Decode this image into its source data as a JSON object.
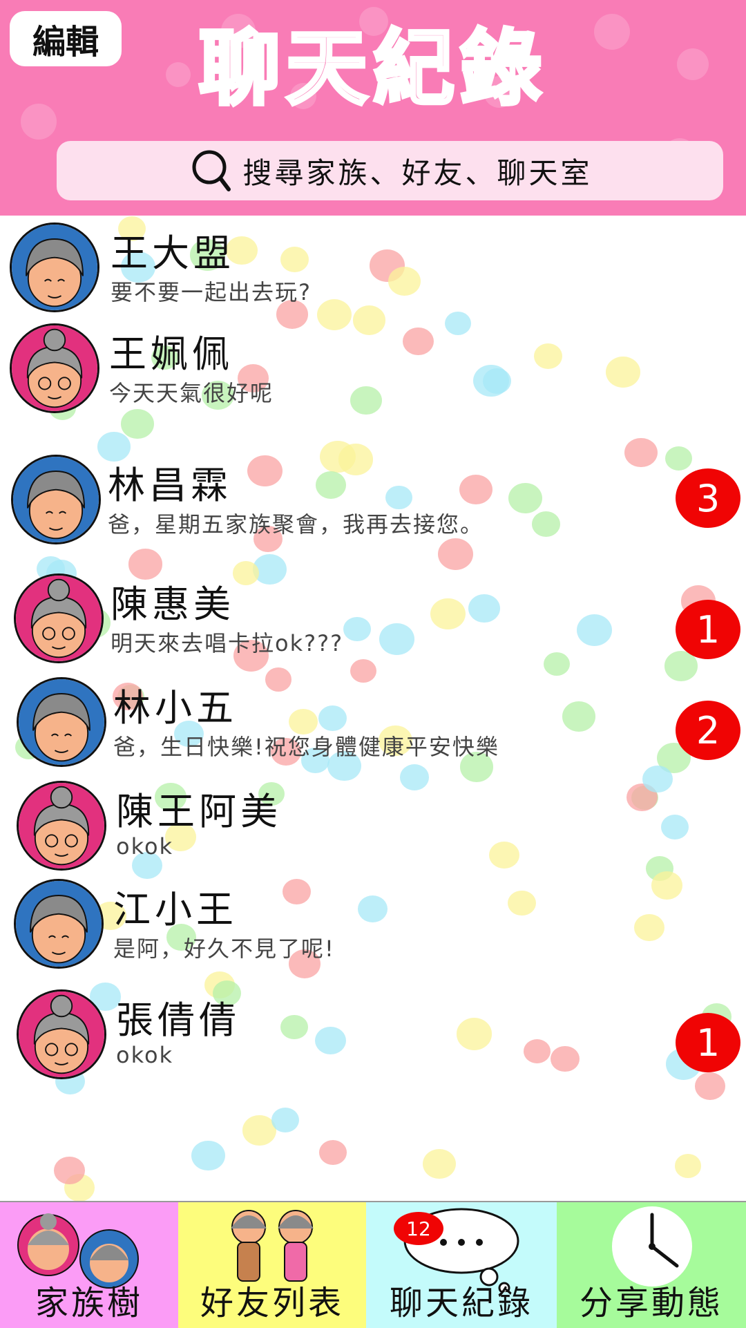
{
  "header": {
    "edit_label": "編輯",
    "title": "聊天紀錄",
    "search_placeholder": "搜尋家族、好友、聊天室"
  },
  "colors": {
    "header_bg": "#f97cb6",
    "badge_red": "#f00404",
    "avatar_blue": "#2f74c0",
    "avatar_pink": "#e2317e",
    "nav_family": "#fb9cf6",
    "nav_friends": "#fdfd7c",
    "nav_chat": "#c4fbfb",
    "nav_share": "#a6fb9b"
  },
  "chats": [
    {
      "name": "王大盟",
      "message": "要不要一起出去玩?",
      "avatar": "grandpa-avatar",
      "unread": ""
    },
    {
      "name": "王姵佩",
      "message": "今天天氣很好呢",
      "avatar": "grandma-avatar",
      "unread": ""
    },
    {
      "name": "林昌霖",
      "message": "爸，星期五家族聚會，我再去接您。",
      "avatar": "grandpa-avatar",
      "unread": "3"
    },
    {
      "name": "陳惠美",
      "message": "明天來去唱卡拉ok???",
      "avatar": "grandma-avatar",
      "unread": "1"
    },
    {
      "name": "林小五",
      "message": "爸，生日快樂!祝您身體健康平安快樂",
      "avatar": "grandpa-avatar",
      "unread": "2"
    },
    {
      "name": "陳王阿美",
      "message": "okok",
      "avatar": "grandma-avatar",
      "unread": ""
    },
    {
      "name": "江小王",
      "message": "是阿，好久不見了呢!",
      "avatar": "grandpa-avatar",
      "unread": ""
    },
    {
      "name": "張倩倩",
      "message": "okok",
      "avatar": "grandma-avatar",
      "unread": "1"
    }
  ],
  "nav": {
    "family_label": "家族樹",
    "friends_label": "好友列表",
    "chat_label": "聊天紀錄",
    "chat_badge": "12",
    "share_label": "分享動態"
  }
}
